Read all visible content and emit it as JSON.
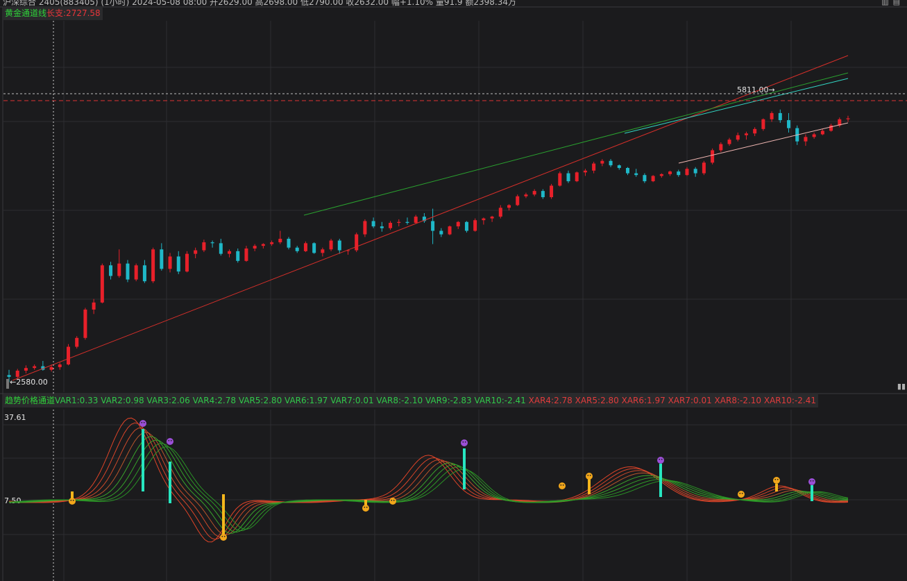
{
  "header": {
    "info_text": "沪深综合 2405(883405) (1小时) 2024-05-08 08:00 开2629.00 高2698.00 低2790.00 收2632.00 幅+1.10% 量91.9 额2398.34万",
    "toolbar_icons": [
      "bar-chart-icon",
      "settings-icon"
    ]
  },
  "main_indicator": {
    "name": "黄金通道线",
    "support_label": "长支:2727.58"
  },
  "sub_indicator": {
    "name": "趋势价格通道",
    "vars": [
      "VAR1:0.33",
      "VAR2:0.98",
      "VAR3:2.06",
      "VAR4:2.78",
      "VAR5:2.80",
      "VAR6:1.97",
      "VAR7:0.01",
      "VAR8:-2.10",
      "VAR9:-2.83",
      "VAR10:-2.41"
    ],
    "xars": [
      "XAR4:2.78",
      "XAR5:2.80",
      "XAR6:1.97",
      "XAR7:0.01",
      "XAR8:-2.10",
      "XAR10:-2.41"
    ]
  },
  "price_annotations": {
    "low_label": "←2580.00",
    "high_label": "5811.00→"
  },
  "sub_axis": {
    "top_value": "37.61",
    "mid_value": "7.50"
  },
  "colors": {
    "up": "#e8202a",
    "down": "#1fb8c8",
    "grid": "#2e2e31",
    "background": "#1b1b1d"
  },
  "chart_data": {
    "type": "candlestick",
    "y_range": [
      2580,
      5811
    ],
    "candles": [
      [
        2640,
        2700,
        2560,
        2620
      ],
      [
        2620,
        2710,
        2600,
        2690
      ],
      [
        2690,
        2750,
        2660,
        2720
      ],
      [
        2720,
        2760,
        2700,
        2740
      ],
      [
        2740,
        2800,
        2690,
        2700
      ],
      [
        2700,
        2760,
        2680,
        2730
      ],
      [
        2730,
        2780,
        2700,
        2760
      ],
      [
        2760,
        2990,
        2750,
        2960
      ],
      [
        2960,
        3080,
        2940,
        3060
      ],
      [
        3060,
        3400,
        3040,
        3380
      ],
      [
        3380,
        3500,
        3330,
        3460
      ],
      [
        3460,
        3900,
        3450,
        3880
      ],
      [
        3880,
        3920,
        3720,
        3760
      ],
      [
        3760,
        4060,
        3740,
        3900
      ],
      [
        3900,
        3940,
        3690,
        3720
      ],
      [
        3720,
        3900,
        3700,
        3880
      ],
      [
        3880,
        3940,
        3680,
        3700
      ],
      [
        3700,
        4080,
        3680,
        4060
      ],
      [
        4060,
        4130,
        3820,
        3840
      ],
      [
        3840,
        4020,
        3800,
        3980
      ],
      [
        3980,
        4040,
        3780,
        3810
      ],
      [
        3810,
        4040,
        3800,
        4010
      ],
      [
        4010,
        4080,
        3960,
        4050
      ],
      [
        4050,
        4170,
        4030,
        4140
      ],
      [
        4140,
        4160,
        4080,
        4130
      ],
      [
        4130,
        4180,
        3990,
        4010
      ],
      [
        4010,
        4060,
        3970,
        4040
      ],
      [
        4040,
        4070,
        3910,
        3930
      ],
      [
        3930,
        4100,
        3920,
        4070
      ],
      [
        4070,
        4120,
        4040,
        4100
      ],
      [
        4100,
        4130,
        4070,
        4120
      ],
      [
        4120,
        4160,
        4100,
        4140
      ],
      [
        4140,
        4270,
        4120,
        4180
      ],
      [
        4180,
        4200,
        4060,
        4080
      ],
      [
        4080,
        4100,
        4020,
        4040
      ],
      [
        4040,
        4150,
        4030,
        4130
      ],
      [
        4130,
        4140,
        4010,
        4020
      ],
      [
        4020,
        4080,
        3980,
        4060
      ],
      [
        4060,
        4180,
        4040,
        4160
      ],
      [
        4160,
        4180,
        4010,
        4050
      ],
      [
        4050,
        4060,
        4000,
        4050
      ],
      [
        4050,
        4250,
        4030,
        4230
      ],
      [
        4230,
        4400,
        4200,
        4380
      ],
      [
        4380,
        4420,
        4300,
        4320
      ],
      [
        4320,
        4370,
        4260,
        4300
      ],
      [
        4300,
        4380,
        4280,
        4360
      ],
      [
        4360,
        4400,
        4320,
        4370
      ],
      [
        4370,
        4420,
        4340,
        4360
      ],
      [
        4360,
        4450,
        4350,
        4430
      ],
      [
        4430,
        4470,
        4360,
        4380
      ],
      [
        4380,
        4520,
        4120,
        4270
      ],
      [
        4270,
        4300,
        4200,
        4230
      ],
      [
        4230,
        4330,
        4220,
        4320
      ],
      [
        4320,
        4380,
        4290,
        4370
      ],
      [
        4370,
        4380,
        4250,
        4270
      ],
      [
        4270,
        4410,
        4260,
        4390
      ],
      [
        4390,
        4420,
        4340,
        4410
      ],
      [
        4410,
        4440,
        4370,
        4430
      ],
      [
        4430,
        4560,
        4410,
        4530
      ],
      [
        4530,
        4570,
        4500,
        4560
      ],
      [
        4560,
        4680,
        4550,
        4660
      ],
      [
        4660,
        4700,
        4640,
        4680
      ],
      [
        4680,
        4740,
        4660,
        4720
      ],
      [
        4720,
        4740,
        4630,
        4650
      ],
      [
        4650,
        4800,
        4630,
        4780
      ],
      [
        4780,
        4940,
        4770,
        4920
      ],
      [
        4920,
        4950,
        4810,
        4830
      ],
      [
        4830,
        4940,
        4820,
        4930
      ],
      [
        4930,
        4970,
        4890,
        4950
      ],
      [
        4950,
        5050,
        4920,
        5030
      ],
      [
        5030,
        5080,
        5000,
        5060
      ],
      [
        5060,
        5080,
        4990,
        5010
      ],
      [
        5010,
        5020,
        4960,
        4980
      ],
      [
        4980,
        4990,
        4900,
        4920
      ],
      [
        4920,
        4970,
        4880,
        4900
      ],
      [
        4900,
        4920,
        4810,
        4830
      ],
      [
        4830,
        4900,
        4820,
        4890
      ],
      [
        4890,
        4920,
        4870,
        4910
      ],
      [
        4910,
        4950,
        4890,
        4940
      ],
      [
        4940,
        4960,
        4880,
        4900
      ],
      [
        4900,
        4990,
        4890,
        4970
      ],
      [
        4970,
        4990,
        4880,
        4920
      ],
      [
        4920,
        5060,
        4900,
        5040
      ],
      [
        5040,
        5200,
        5020,
        5180
      ],
      [
        5180,
        5270,
        5160,
        5250
      ],
      [
        5250,
        5320,
        5230,
        5300
      ],
      [
        5300,
        5380,
        5280,
        5350
      ],
      [
        5350,
        5390,
        5300,
        5370
      ],
      [
        5370,
        5440,
        5340,
        5420
      ],
      [
        5420,
        5540,
        5400,
        5530
      ],
      [
        5530,
        5620,
        5500,
        5600
      ],
      [
        5600,
        5640,
        5490,
        5520
      ],
      [
        5520,
        5600,
        5380,
        5430
      ],
      [
        5430,
        5460,
        5240,
        5280
      ],
      [
        5280,
        5360,
        5230,
        5330
      ],
      [
        5330,
        5380,
        5310,
        5360
      ],
      [
        5360,
        5420,
        5350,
        5400
      ],
      [
        5400,
        5480,
        5390,
        5460
      ],
      [
        5460,
        5550,
        5440,
        5530
      ],
      [
        5530,
        5570,
        5500,
        5540
      ]
    ],
    "oscillator_range": [
      -20,
      37.61
    ]
  }
}
